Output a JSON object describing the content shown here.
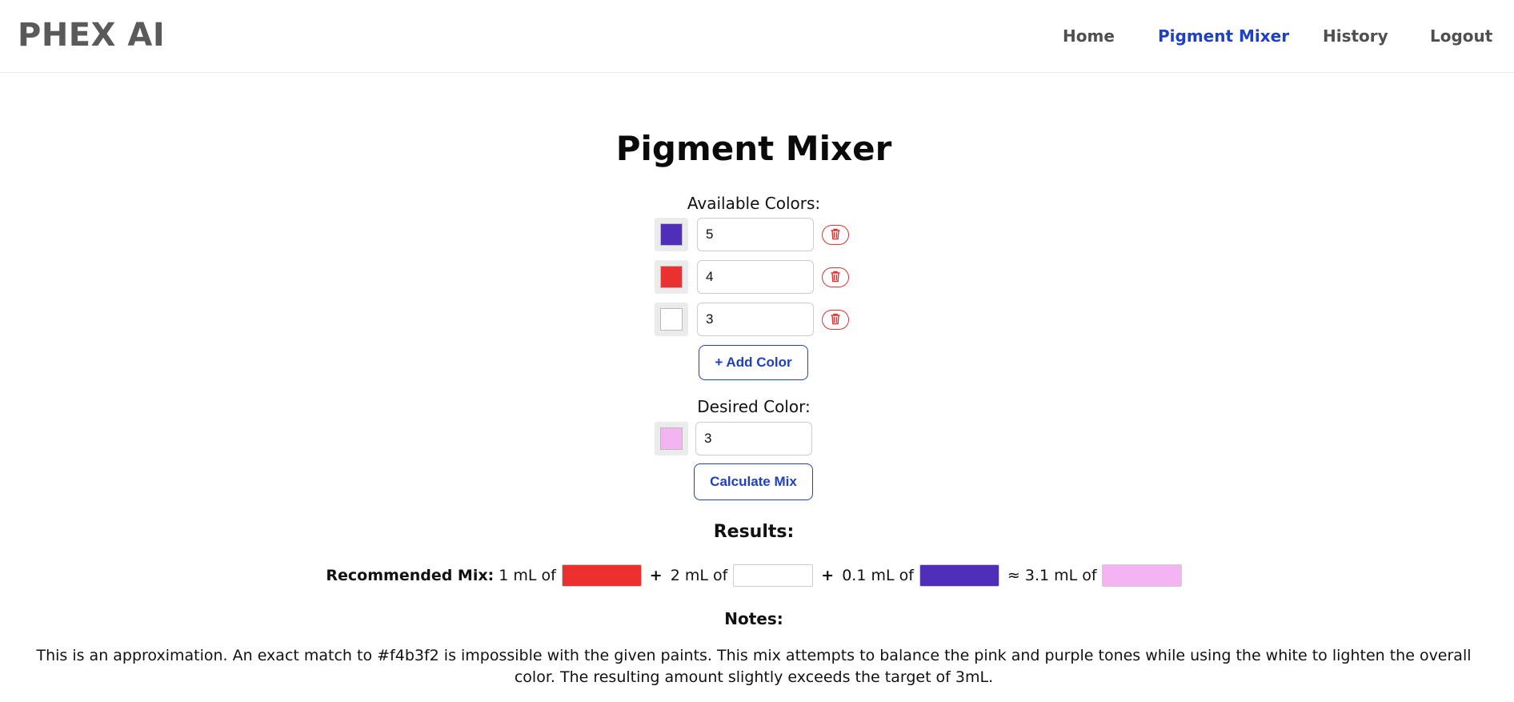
{
  "app": {
    "brand": "PHEX AI"
  },
  "nav": {
    "home": "Home",
    "pigment_mixer": "Pigment Mixer",
    "history": "History",
    "logout": "Logout"
  },
  "page_title": "Pigment Mixer",
  "available": {
    "label": "Available Colors:",
    "colors": [
      {
        "hex": "#4f2fba",
        "amount": "5"
      },
      {
        "hex": "#ec2f2f",
        "amount": "4"
      },
      {
        "hex": "#ffffff",
        "amount": "3"
      }
    ],
    "add_button": "+ Add Color"
  },
  "desired": {
    "label": "Desired Color:",
    "hex": "#f4b3f2",
    "amount": "3",
    "calc_button": "Calculate Mix"
  },
  "results": {
    "heading": "Results:",
    "recommended_label": "Recommended Mix:",
    "parts": [
      {
        "text": "1 mL of",
        "hex": "#ec2f2f"
      },
      {
        "text": "2 mL of",
        "hex": "#ffffff"
      },
      {
        "text": "0.1 mL of",
        "hex": "#4f2fba"
      }
    ],
    "plus": "+",
    "total_text": "≈ 3.1 mL of",
    "total_hex": "#f4b3f2",
    "notes_heading": "Notes:",
    "notes": "This is an approximation. An exact match to #f4b3f2 is impossible with the given paints. This mix attempts to balance the pink and purple tones while using the white to lighten the overall color. The resulting amount slightly exceeds the target of 3mL."
  },
  "colors": {
    "accent": "#1f3fc4",
    "danger": "#e03333"
  },
  "icons": {
    "delete": "trash-icon"
  }
}
